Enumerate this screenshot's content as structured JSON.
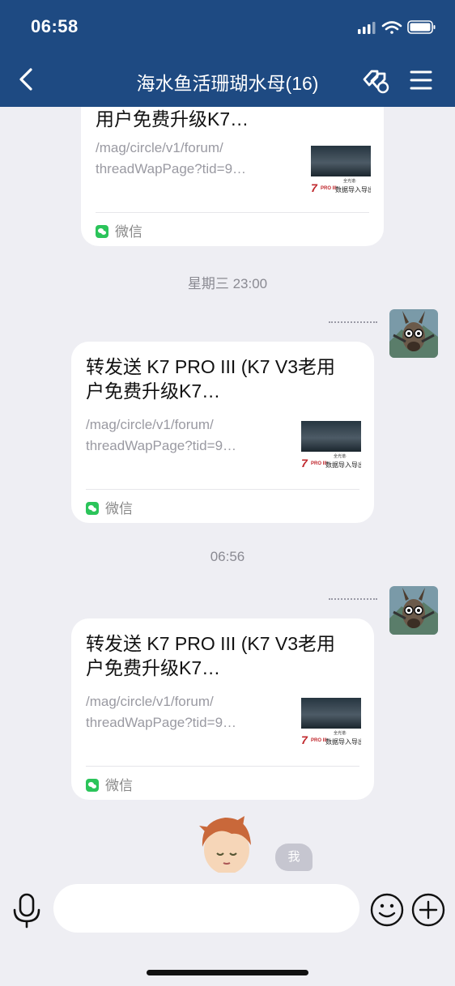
{
  "status_bar": {
    "time": "06:58"
  },
  "header": {
    "title": "海水鱼活珊瑚水母(16)"
  },
  "messages": [
    {
      "title": "用户免费升级K7…",
      "desc_line1": "/mag/circle/v1/forum/",
      "desc_line2": "threadWapPage?tid=9…",
      "source": "微信",
      "thumb_small1": "全光谱·",
      "thumb_pro": "PRO III",
      "thumb_small2": "数据导入导出"
    },
    {
      "timestamp": "星期三 23:00",
      "title": "转发送 K7 PRO III (K7 V3老用户免费升级K7…",
      "desc_line1": "/mag/circle/v1/forum/",
      "desc_line2": "threadWapPage?tid=9…",
      "source": "微信",
      "thumb_small1": "全光谱·",
      "thumb_pro": "PRO III",
      "thumb_small2": "数据导入导出"
    },
    {
      "timestamp": "06:56",
      "title": "转发送 K7 PRO III (K7 V3老用户免费升级K7…",
      "desc_line1": "/mag/circle/v1/forum/",
      "desc_line2": "threadWapPage?tid=9…",
      "source": "微信",
      "thumb_small1": "全光谱·",
      "thumb_pro": "PRO III",
      "thumb_small2": "数据导入导出"
    }
  ],
  "me_label": "我",
  "colors": {
    "header_bg": "#1e4a82",
    "background": "#eeeef3",
    "wechat_green": "#2bc45a"
  }
}
